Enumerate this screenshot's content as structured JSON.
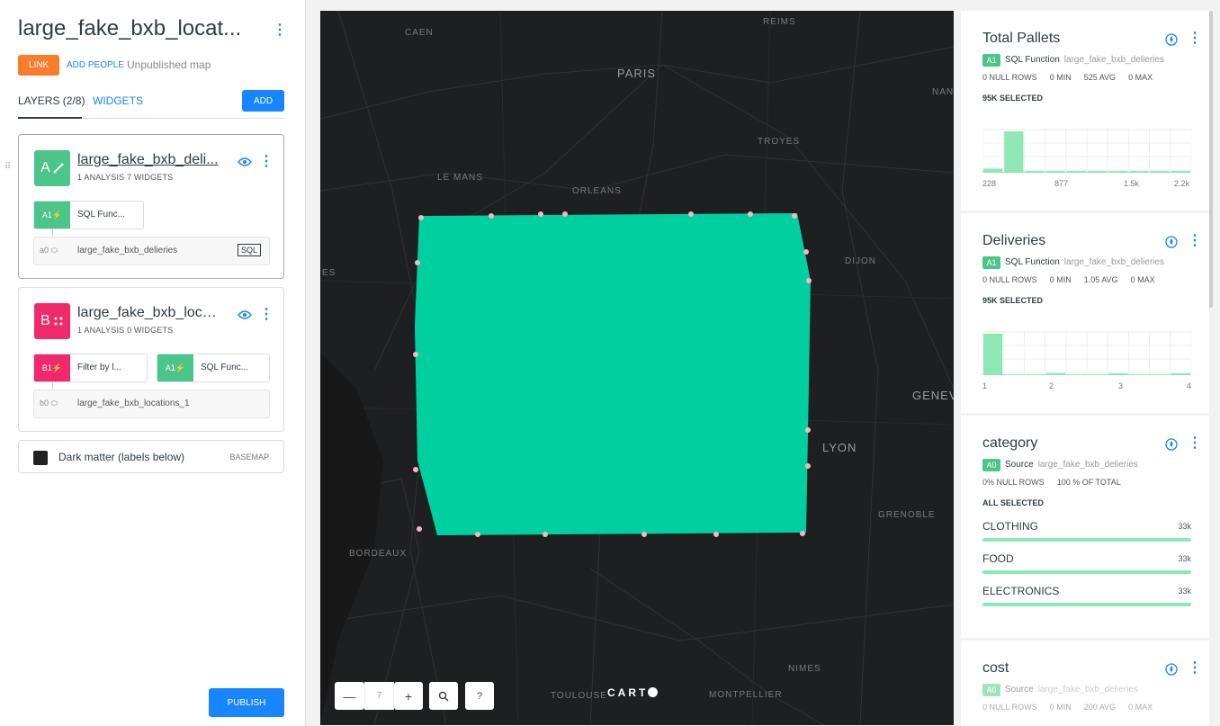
{
  "header": {
    "map_title": "large_fake_bxb_locat...",
    "link_label": "LINK",
    "add_people_label": "ADD PEOPLE",
    "status": "Unpublished map"
  },
  "tabs": {
    "layers": "LAYERS (2/8)",
    "widgets": "WIDGETS",
    "add": "ADD"
  },
  "layers": [
    {
      "letter": "A",
      "name": "large_fake_bxb_deli...",
      "analysis": "1 ANALYSIS",
      "widgets": "7 WIDGETS",
      "color": "#4cc58b",
      "nodes": [
        {
          "id": "A1",
          "label": "SQL Func..."
        }
      ],
      "source": {
        "id": "a0",
        "label": "large_fake_bxb_delieries",
        "tag": "SQL"
      }
    },
    {
      "letter": "B",
      "name": "large_fake_bxb_loca...",
      "analysis": "1 ANALYSIS",
      "widgets": "0 WIDGETS",
      "color": "#f0296a",
      "nodes": [
        {
          "id": "B1",
          "label": "Filter by l..."
        },
        {
          "id": "A1",
          "label": "SQL Func..."
        }
      ],
      "source": {
        "id": "b0",
        "label": "large_fake_bxb_locations_1"
      }
    }
  ],
  "basemap": {
    "name": "Dark matter (labels below)",
    "tag": "BASEMAP"
  },
  "publish_label": "PUBLISH",
  "map": {
    "zoom": "7",
    "logo": "CART",
    "polygon_color": "#00cfa0",
    "cities": [
      {
        "name": "CAEN"
      },
      {
        "name": "REIMS"
      },
      {
        "name": "PARIS"
      },
      {
        "name": "TROYES"
      },
      {
        "name": "LE MANS"
      },
      {
        "name": "ORLEANS"
      },
      {
        "name": "DIJON"
      },
      {
        "name": "GENEV"
      },
      {
        "name": "LYON"
      },
      {
        "name": "GRENOBLE"
      },
      {
        "name": "BORDEAUX"
      },
      {
        "name": "NIMES"
      },
      {
        "name": "TOULOUSE"
      },
      {
        "name": "MONTPELLIER"
      },
      {
        "name": "NAN"
      },
      {
        "name": "ES"
      }
    ]
  },
  "widgets": [
    {
      "title": "Total Pallets",
      "tag": "A1",
      "fn": "SQL Function",
      "ds": "large_fake_bxb_delieries",
      "stats": [
        "0 NULL ROWS",
        "0 MIN",
        "525 AVG",
        "0 MAX"
      ],
      "selected": "95K SELECTED",
      "histogram": [
        0.1,
        1.0,
        0.03,
        0.03,
        0.03,
        0.03,
        0.03,
        0.03,
        0.03,
        0.03
      ],
      "axis": [
        "228",
        "877",
        "1.5k",
        "2.2k"
      ]
    },
    {
      "title": "Deliveries",
      "tag": "A1",
      "fn": "SQL Function",
      "ds": "large_fake_bxb_delieries",
      "stats": [
        "0 NULL ROWS",
        "0 MIN",
        "1.05 AVG",
        "0 MAX"
      ],
      "selected": "95K SELECTED",
      "histogram": [
        1.0,
        0.0,
        0.0,
        0.05,
        0.0,
        0.0,
        0.04,
        0.0,
        0.0,
        0.04
      ],
      "axis": [
        "1",
        "2",
        "3",
        "4"
      ]
    },
    {
      "title": "category",
      "tag": "A0",
      "fn": "Source",
      "ds": "large_fake_bxb_delieries",
      "stats": [
        "0% NULL ROWS",
        "100 % OF TOTAL"
      ],
      "selected": "ALL SELECTED",
      "categories": [
        {
          "name": "CLOTHING",
          "value": "33k"
        },
        {
          "name": "FOOD",
          "value": "33k"
        },
        {
          "name": "ELECTRONICS",
          "value": "33k"
        }
      ]
    },
    {
      "title": "cost",
      "tag": "A0",
      "fn": "Source",
      "ds": "large_fake_bxb_delieries",
      "stats": [
        "0 NULL ROWS",
        "0 MIN",
        "200 AVG",
        "0 MAX"
      ]
    }
  ]
}
